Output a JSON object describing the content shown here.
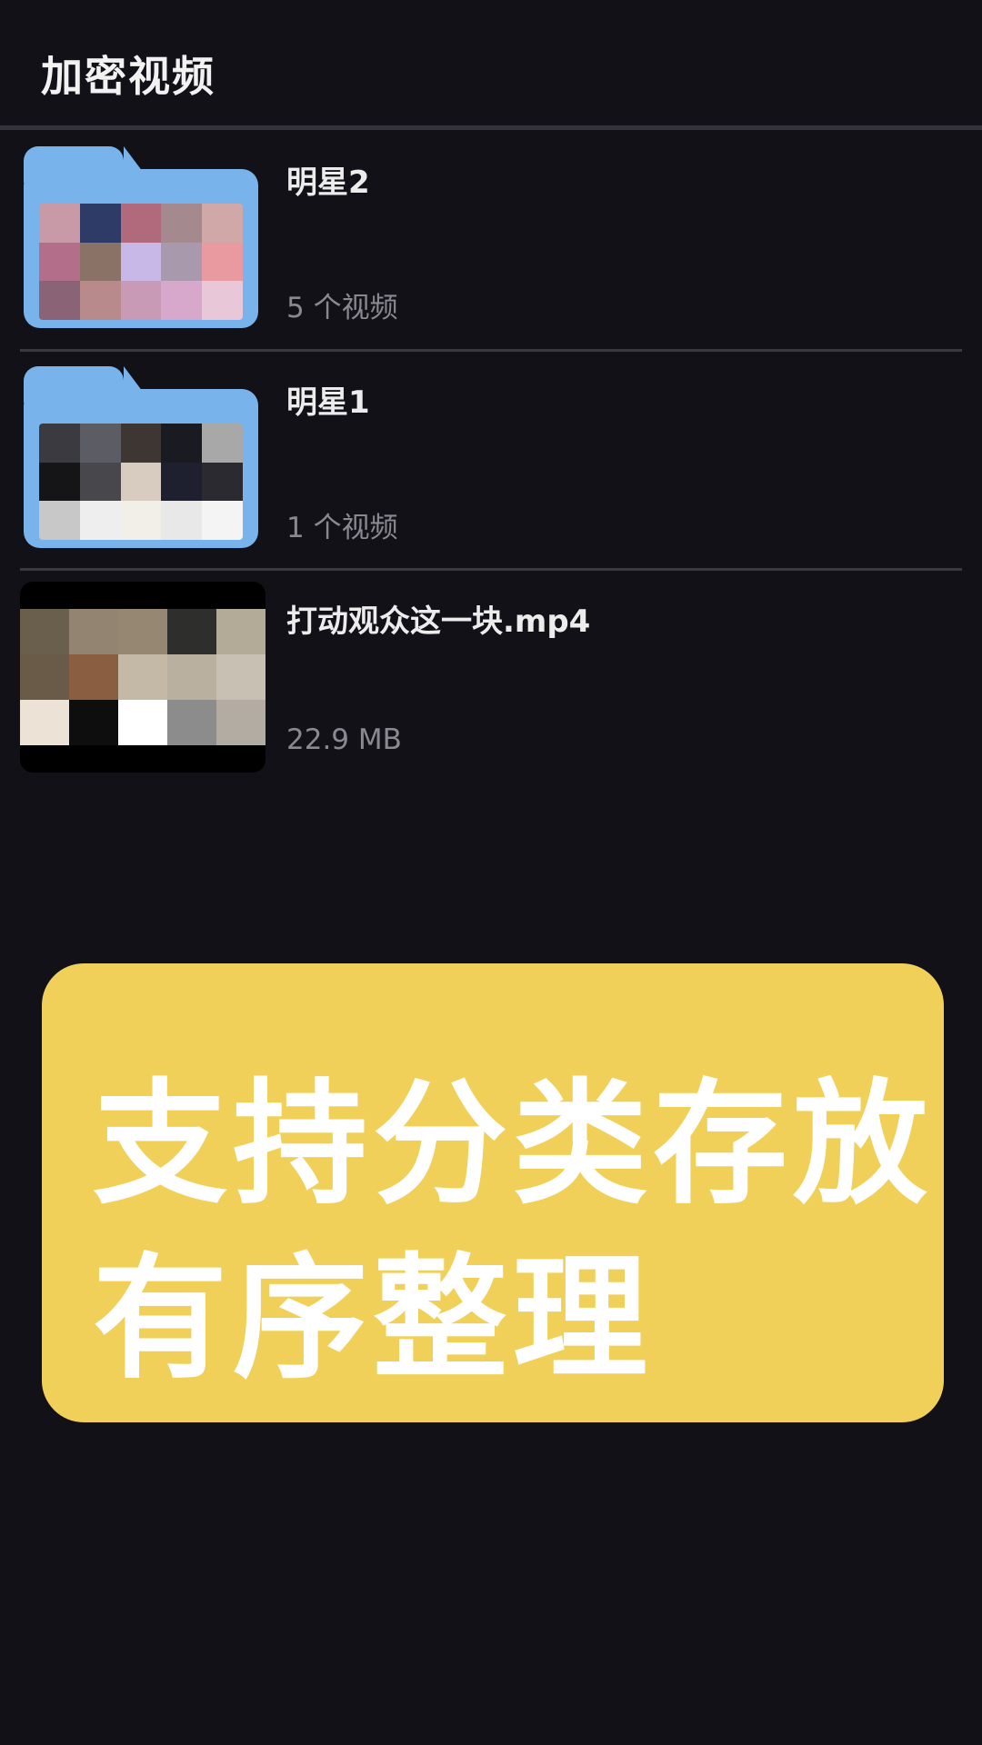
{
  "header": {
    "title": "加密视频"
  },
  "items": [
    {
      "title": "明星2",
      "meta": "5 个视频",
      "kind": "folder"
    },
    {
      "title": "明星1",
      "meta": "1 个视频",
      "kind": "folder"
    },
    {
      "title": "打动观众这一块.mp4",
      "meta": "22.9 MB",
      "kind": "video"
    }
  ],
  "promo": {
    "line1": "支持分类存放",
    "line2": "有序整理"
  },
  "colors": {
    "background": "#131118",
    "folder": "#79b3ec",
    "promo": "#f1d05a"
  }
}
